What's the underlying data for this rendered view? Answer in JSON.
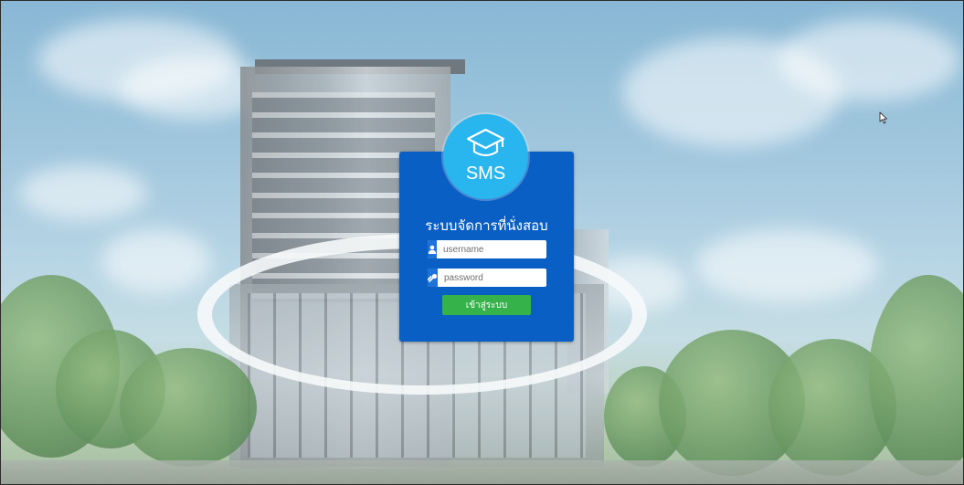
{
  "logo": {
    "text": "SMS",
    "icon": "graduation-cap-icon",
    "color": "#29b5ee"
  },
  "login": {
    "title": "ระบบจัดการที่นั่งสอบ",
    "username_placeholder": "username",
    "password_placeholder": "password",
    "submit_label": "เข้าสู่ระบบ",
    "user_icon": "user-icon",
    "password_icon": "key-icon"
  },
  "colors": {
    "card": "#0a5fc4",
    "icon_box": "#1e73d8",
    "submit": "#36b24a"
  }
}
